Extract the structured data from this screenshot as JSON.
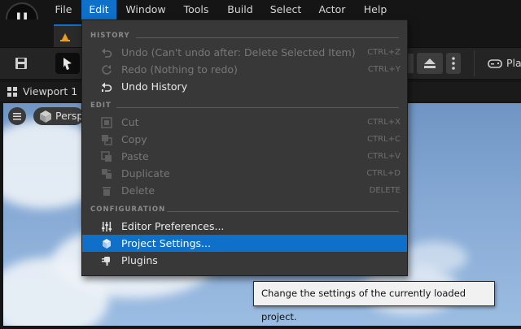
{
  "menu_bar": {
    "items": [
      "File",
      "Edit",
      "Window",
      "Tools",
      "Build",
      "Select",
      "Actor",
      "Help"
    ],
    "active_index": 1
  },
  "toolbar": {
    "play_label": "Pla"
  },
  "viewport": {
    "tab_label": "Viewport 1",
    "perspective_label": "Persp"
  },
  "edit_menu": {
    "sections": [
      {
        "title": "HISTORY",
        "items": [
          {
            "label": "Undo (Can't undo after: Delete Selected Item)",
            "shortcut": "CTRL+Z",
            "enabled": false,
            "icon": "undo-icon"
          },
          {
            "label": "Redo (Nothing to redo)",
            "shortcut": "CTRL+Y",
            "enabled": false,
            "icon": "redo-icon"
          },
          {
            "label": "Undo History",
            "shortcut": "",
            "enabled": true,
            "icon": "history-icon"
          }
        ]
      },
      {
        "title": "EDIT",
        "items": [
          {
            "label": "Cut",
            "shortcut": "CTRL+X",
            "enabled": false,
            "icon": "cut-icon"
          },
          {
            "label": "Copy",
            "shortcut": "CTRL+C",
            "enabled": false,
            "icon": "copy-icon"
          },
          {
            "label": "Paste",
            "shortcut": "CTRL+V",
            "enabled": false,
            "icon": "paste-icon"
          },
          {
            "label": "Duplicate",
            "shortcut": "CTRL+D",
            "enabled": false,
            "icon": "duplicate-icon"
          },
          {
            "label": "Delete",
            "shortcut": "DELETE",
            "enabled": false,
            "icon": "trash-icon"
          }
        ]
      },
      {
        "title": "CONFIGURATION",
        "items": [
          {
            "label": "Editor Preferences...",
            "shortcut": "",
            "enabled": true,
            "icon": "sliders-icon"
          },
          {
            "label": "Project Settings...",
            "shortcut": "",
            "enabled": true,
            "selected": true,
            "icon": "project-settings-icon"
          },
          {
            "label": "Plugins",
            "shortcut": "",
            "enabled": true,
            "icon": "plug-icon"
          }
        ]
      }
    ]
  },
  "tooltip": {
    "text": "Change the settings of the currently loaded project."
  },
  "colors": {
    "accent": "#0e70c9",
    "menu_bg": "#383838",
    "app_bg": "#151515"
  }
}
